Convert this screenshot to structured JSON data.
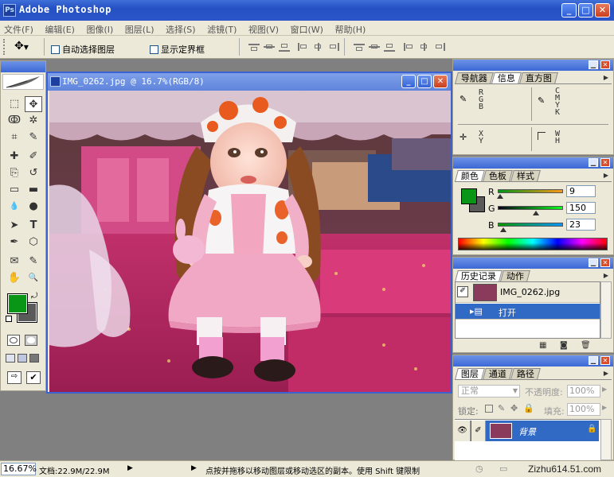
{
  "app": {
    "title": "Adobe Photoshop",
    "logo_text": "Ps"
  },
  "window_buttons": {
    "minimize": "_",
    "maximize": "□",
    "close": "✕"
  },
  "menu": [
    "文件(F)",
    "编辑(E)",
    "图像(I)",
    "图层(L)",
    "选择(S)",
    "滤镜(T)",
    "视图(V)",
    "窗口(W)",
    "帮助(H)"
  ],
  "options": {
    "auto_select_layer": "自动选择图层",
    "show_bounding_box": "显示定界框"
  },
  "document": {
    "title": "IMG_0262.jpg @ 16.7%(RGB/8)",
    "zoom": "16.67%"
  },
  "panels": {
    "info": {
      "tabs": [
        "导航器",
        "信息",
        "直方图"
      ],
      "active_tab": 1,
      "rgb_labels": "R\nG\nB",
      "cmyk_labels": "C\nM\nY\nK",
      "xy_labels": "X\nY",
      "wh_labels": "W\nH"
    },
    "color": {
      "tabs": [
        "颜色",
        "色板",
        "样式"
      ],
      "active_tab": 0,
      "channels": [
        {
          "label": "R",
          "value": "9",
          "fraction": 0.035
        },
        {
          "label": "G",
          "value": "150",
          "fraction": 0.588
        },
        {
          "label": "B",
          "value": "23",
          "fraction": 0.09
        }
      ],
      "foreground": "#099617",
      "background": "#5a5a5a"
    },
    "history": {
      "tabs": [
        "历史记录",
        "动作"
      ],
      "active_tab": 0,
      "snapshot": "IMG_0262.jpg",
      "states": [
        "打开"
      ]
    },
    "layers": {
      "tabs": [
        "图层",
        "通道",
        "路径"
      ],
      "active_tab": 0,
      "blend_mode": "正常",
      "opacity_label": "不透明度:",
      "opacity_value": "100%",
      "lock_label": "锁定:",
      "fill_label": "填充:",
      "fill_value": "100%",
      "layer_name": "背景"
    }
  },
  "status": {
    "zoom": "16.67%",
    "doc_size": "文档:22.9M/22.9M",
    "hint": "点按并拖移以移动图层或移动选区的副本。使用 Shift 键限制",
    "watermark": "Zizhu614.51.com"
  },
  "tool_icons": {
    "marquee": "⬚",
    "move": "✥",
    "lasso": "ↂ",
    "magic_wand": "✲",
    "crop": "⌗",
    "slice": "✎",
    "healing": "✚",
    "brush": "✐",
    "stamp": "⎘",
    "history_brush": "↺",
    "eraser": "▭",
    "gradient": "▬",
    "blur": "💧",
    "dodge": "●",
    "path_select": "➤",
    "type": "T",
    "pen": "✒",
    "shape": "⬡",
    "notes": "✉",
    "eyedropper": "✎",
    "hand": "✋",
    "zoom": "🔍"
  }
}
